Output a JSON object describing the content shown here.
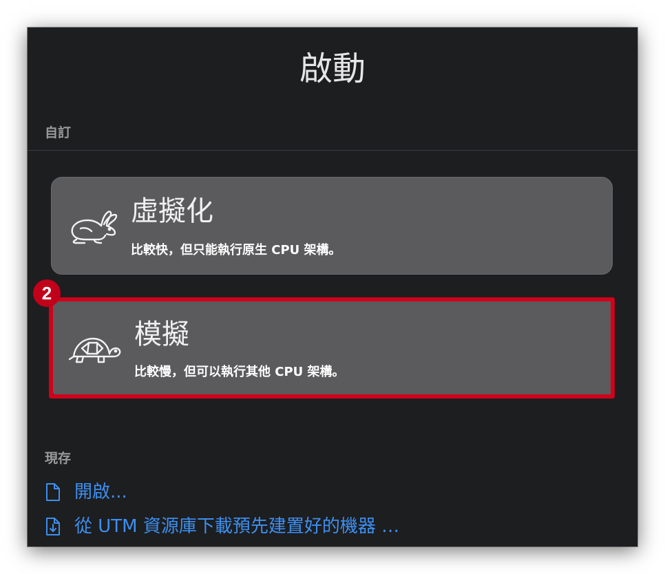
{
  "window": {
    "title": "啟動"
  },
  "sections": {
    "custom_label": "自訂",
    "existing_label": "現存"
  },
  "options": [
    {
      "title": "虛擬化",
      "description": "比較快，但只能執行原生 CPU 架構。",
      "icon": "rabbit-icon"
    },
    {
      "title": "模擬",
      "description": "比較慢，但可以執行其他 CPU 架構。",
      "icon": "turtle-icon"
    }
  ],
  "annotation": {
    "step": "2",
    "color": "#d0021b"
  },
  "links": {
    "open": "開啟...",
    "gallery": "從 UTM 資源庫下載預先建置好的機器 …"
  },
  "colors": {
    "background": "#1d1e20",
    "card": "#5b5b5e",
    "link": "#3d8ff0"
  }
}
